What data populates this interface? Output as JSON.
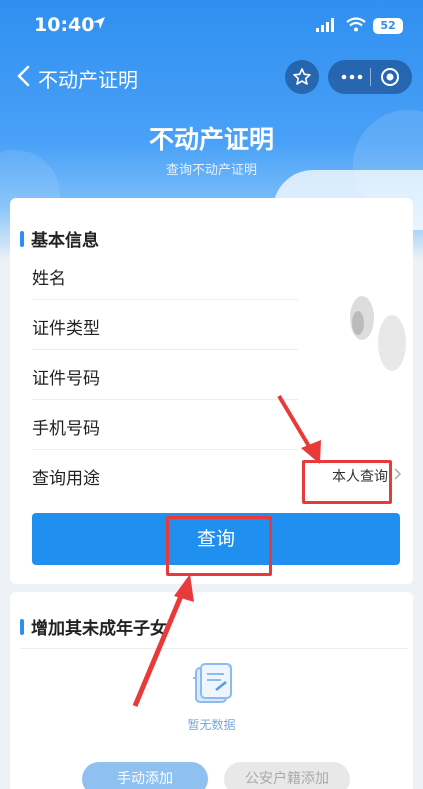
{
  "status_bar": {
    "time": "10:40",
    "battery": "52"
  },
  "nav": {
    "title": "不动产证明"
  },
  "hero": {
    "title": "不动产证明",
    "subtitle": "查询不动产证明"
  },
  "basic_info": {
    "title": "基本信息",
    "fields": [
      {
        "label": "姓名"
      },
      {
        "label": "证件类型"
      },
      {
        "label": "证件号码"
      },
      {
        "label": "手机号码"
      },
      {
        "label": "查询用途",
        "value": "本人查询"
      }
    ],
    "query_button": "查询"
  },
  "minor_children": {
    "title": "增加其未成年子女",
    "empty_text": "暂无数据",
    "manual_add_button": "手动添加",
    "police_add_button": "公安户籍添加"
  },
  "colors": {
    "accent": "#1f8ff0",
    "annotation": "#e83a3a"
  }
}
